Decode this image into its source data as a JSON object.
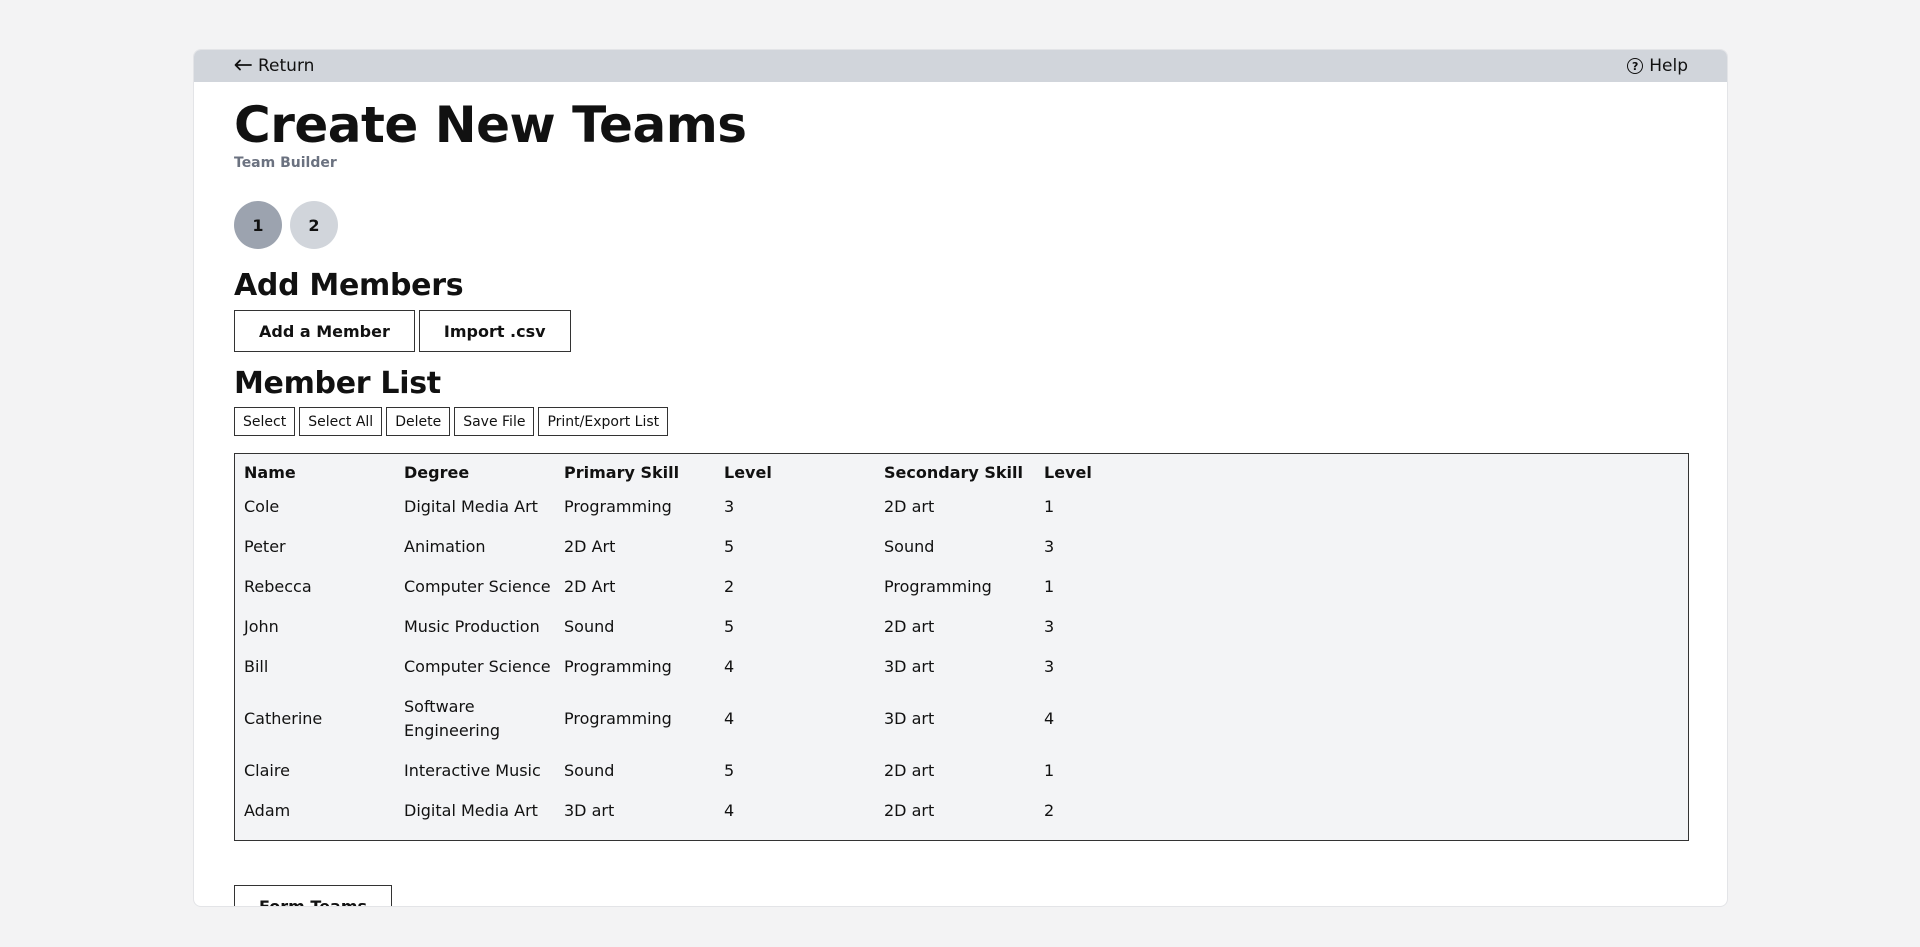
{
  "topbar": {
    "return_label": "Return",
    "help_label": "Help"
  },
  "header": {
    "title": "Create New Teams",
    "subtitle": "Team Builder"
  },
  "steps": [
    "1",
    "2"
  ],
  "add_members": {
    "title": "Add Members",
    "add_member_label": "Add a Member",
    "import_label": "Import .csv"
  },
  "member_list": {
    "title": "Member List",
    "actions": [
      "Select",
      "Select All",
      "Delete",
      "Save File",
      "Print/Export List"
    ],
    "columns": [
      "Name",
      "Degree",
      "Primary Skill",
      "Level",
      "Secondary Skill",
      "Level"
    ],
    "rows": [
      [
        "Cole",
        "Digital Media Art",
        "Programming",
        "3",
        "2D art",
        "1"
      ],
      [
        "Peter",
        "Animation",
        "2D Art",
        "5",
        "Sound",
        "3"
      ],
      [
        "Rebecca",
        "Computer Science",
        "2D Art",
        "2",
        "Programming",
        "1"
      ],
      [
        "John",
        "Music Production",
        "Sound",
        "5",
        "2D art",
        "3"
      ],
      [
        "Bill",
        "Computer Science",
        "Programming",
        "4",
        "3D art",
        "3"
      ],
      [
        "Catherine",
        "Software Engineering",
        "Programming",
        "4",
        "3D art",
        "4"
      ],
      [
        "Claire",
        "Interactive Music",
        "Sound",
        "5",
        "2D art",
        "1"
      ],
      [
        "Adam",
        "Digital Media Art",
        "3D art",
        "4",
        "2D art",
        "2"
      ]
    ]
  },
  "form_teams_label": "Form Teams"
}
